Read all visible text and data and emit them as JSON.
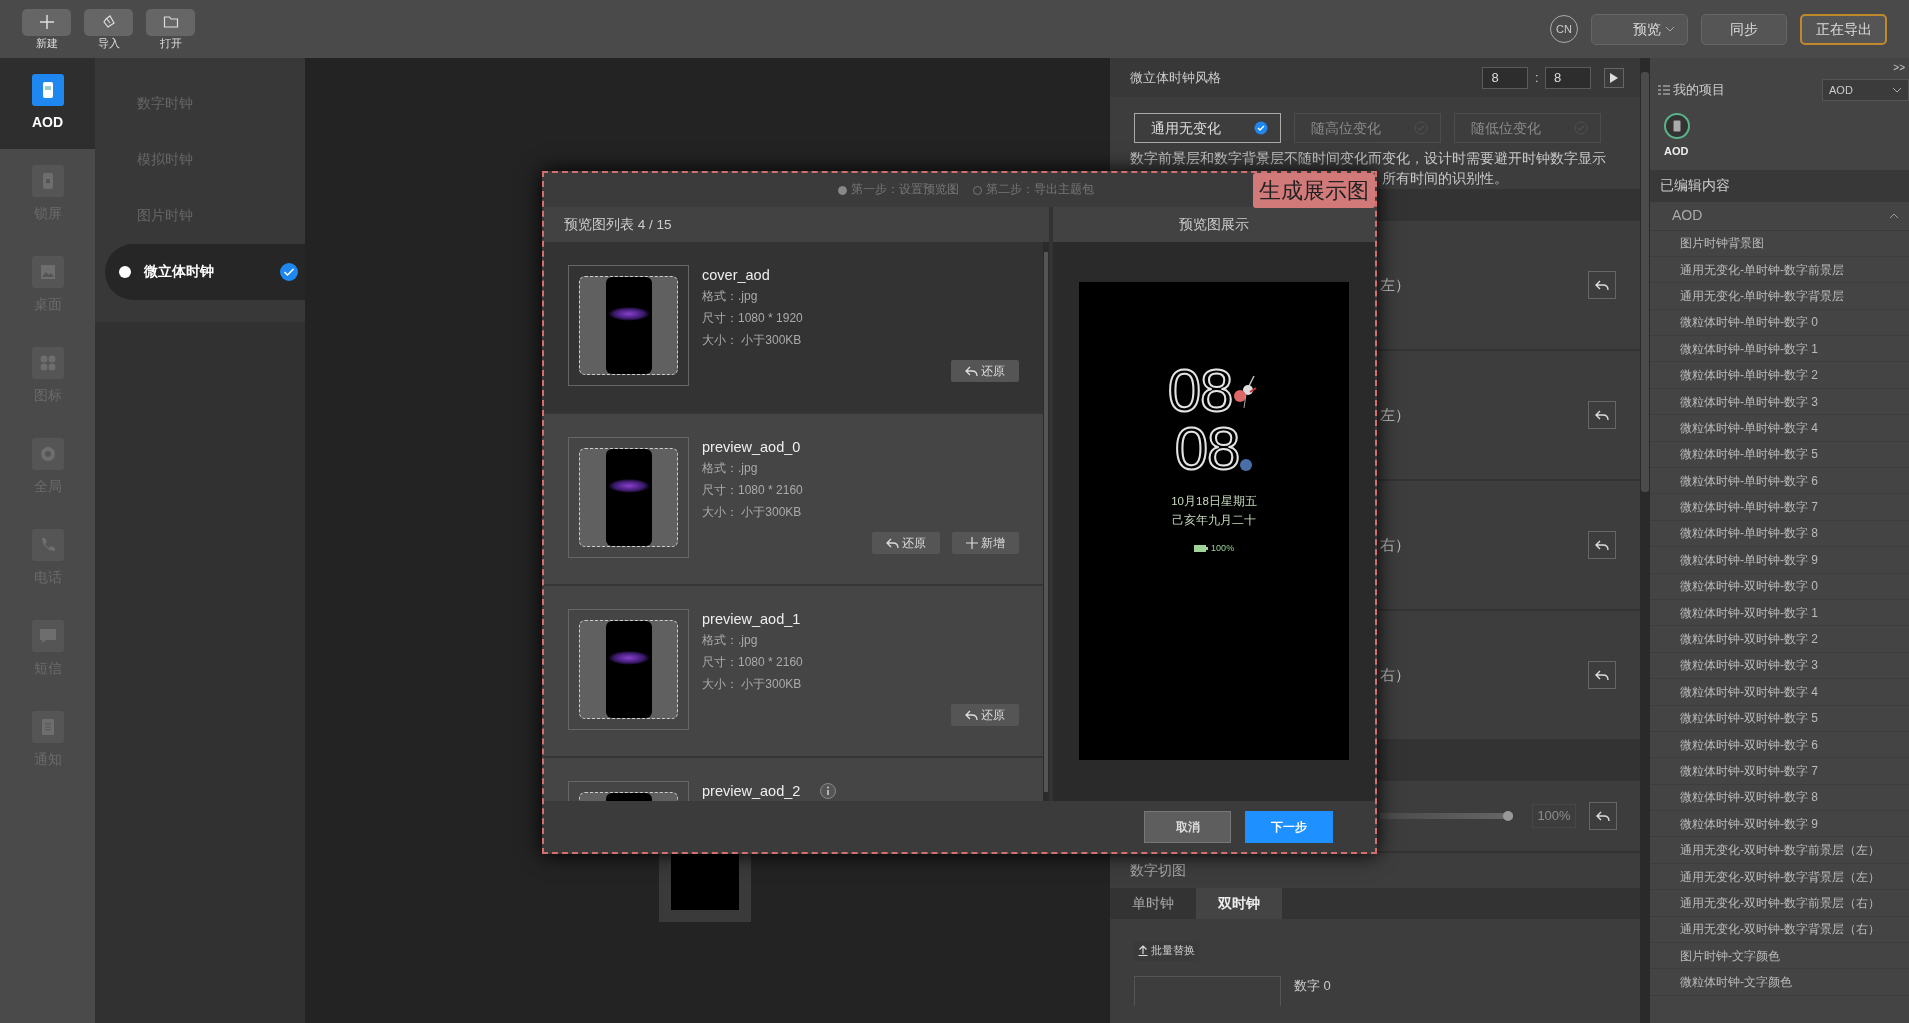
{
  "toolbar": {
    "buttons": [
      {
        "label": "新建",
        "kind": "new"
      },
      {
        "label": "导入",
        "kind": "import"
      },
      {
        "label": "打开",
        "kind": "open"
      }
    ],
    "language": "CN",
    "preview_select": "预览",
    "sync_button": "同步",
    "export_button": {
      "label": "正在导出",
      "active": true
    }
  },
  "nav": [
    {
      "label": "AOD",
      "kind": "aod",
      "selected": true
    },
    {
      "label": "锁屏",
      "kind": "lockscreen",
      "selected": false
    },
    {
      "label": "桌面",
      "kind": "wallpaper",
      "selected": false
    },
    {
      "label": "图标",
      "kind": "icons",
      "selected": false
    },
    {
      "label": "全局",
      "kind": "global",
      "selected": false
    },
    {
      "label": "电话",
      "kind": "phone",
      "selected": false
    },
    {
      "label": "短信",
      "kind": "sms",
      "selected": false
    },
    {
      "label": "通知",
      "kind": "notification",
      "selected": false
    }
  ],
  "clock_types": [
    {
      "label": "数字时钟",
      "selected": false
    },
    {
      "label": "模拟时钟",
      "selected": false
    },
    {
      "label": "图片时钟",
      "selected": false
    },
    {
      "label": "微立体时钟",
      "selected": true
    }
  ],
  "settings": {
    "title": "微立体时钟风格",
    "hour": "8",
    "separator": ":",
    "minute": "8",
    "styles": [
      {
        "label": "通用无变化",
        "selected": true,
        "disabled": false
      },
      {
        "label": "随高位变化",
        "selected": false,
        "disabled": true
      },
      {
        "label": "随低位变化",
        "selected": false,
        "disabled": true
      }
    ],
    "description": "数字前景层和数字背景层不随时间变化而变化，设计时需要避开时钟数字显示",
    "description_tail": "所有时间的识别性。",
    "layer_rows": [
      {
        "label": "左）"
      },
      {
        "label": "左）"
      },
      {
        "label": "右）"
      },
      {
        "label": "右）"
      }
    ],
    "opacity": {
      "level": 1,
      "reading": "100%"
    },
    "section_title": "数字切图",
    "tabs": [
      {
        "label": "单时钟",
        "selected": false
      },
      {
        "label": "双时钟",
        "selected": true
      }
    ],
    "batch_button": "批量替换",
    "digit_label": "数字 0"
  },
  "project": {
    "expand": ">>",
    "title": "我的项目",
    "select": "AOD",
    "icon_label": "AOD",
    "edited_title": "已编辑内容",
    "group": {
      "label": "AOD",
      "expanded": true,
      "items": [
        "图片时钟背景图",
        "通用无变化-单时钟-数字前景层",
        "通用无变化-单时钟-数字背景层",
        "微粒体时钟-单时钟-数字 0",
        "微粒体时钟-单时钟-数字 1",
        "微粒体时钟-单时钟-数字 2",
        "微粒体时钟-单时钟-数字 3",
        "微粒体时钟-单时钟-数字 4",
        "微粒体时钟-单时钟-数字 5",
        "微粒体时钟-单时钟-数字 6",
        "微粒体时钟-单时钟-数字 7",
        "微粒体时钟-单时钟-数字 8",
        "微粒体时钟-单时钟-数字 9",
        "微粒体时钟-双时钟-数字 0",
        "微粒体时钟-双时钟-数字 1",
        "微粒体时钟-双时钟-数字 2",
        "微粒体时钟-双时钟-数字 3",
        "微粒体时钟-双时钟-数字 4",
        "微粒体时钟-双时钟-数字 5",
        "微粒体时钟-双时钟-数字 6",
        "微粒体时钟-双时钟-数字 7",
        "微粒体时钟-双时钟-数字 8",
        "微粒体时钟-双时钟-数字 9",
        "通用无变化-双时钟-数字前景层（左）",
        "通用无变化-双时钟-数字背景层（左）",
        "通用无变化-双时钟-数字前景层（右）",
        "通用无变化-双时钟-数字背景层（右）",
        "图片时钟-文字颜色",
        "微粒体时钟-文字颜色"
      ]
    }
  },
  "dialog": {
    "annotation": "生成展示图",
    "steps": [
      {
        "label": "第一步：设置预览图",
        "selected": true
      },
      {
        "label": "第二步：导出主题包",
        "selected": false
      }
    ],
    "list_title": "预览图列表 4 / 15",
    "preview_title": "预览图展示",
    "items": [
      {
        "name": "cover_aod",
        "format": "格式：.jpg",
        "dimensions": "尺寸：1080 * 1920",
        "file_size": "大小：  小于300KB",
        "selected": true,
        "info": false,
        "buttons": [
          {
            "kind": "restore",
            "label": "还原"
          }
        ]
      },
      {
        "name": "preview_aod_0",
        "format": "格式：.jpg",
        "dimensions": "尺寸：1080 * 2160",
        "file_size": "大小：  小于300KB",
        "selected": false,
        "info": false,
        "buttons": [
          {
            "kind": "restore",
            "label": "还原"
          },
          {
            "kind": "add",
            "label": "新增"
          }
        ]
      },
      {
        "name": "preview_aod_1",
        "format": "格式：.jpg",
        "dimensions": "尺寸：1080 * 2160",
        "file_size": "大小：  小于300KB",
        "selected": false,
        "info": false,
        "buttons": [
          {
            "kind": "restore",
            "label": "还原"
          }
        ]
      },
      {
        "name": "preview_aod_2",
        "selected": false,
        "info": true
      }
    ],
    "preview": {
      "time": [
        "08",
        "08"
      ],
      "date": "10月18日星期五",
      "lunar": "己亥年九月二十",
      "battery": "100%"
    },
    "cancel": "取消",
    "next": "下一步"
  }
}
